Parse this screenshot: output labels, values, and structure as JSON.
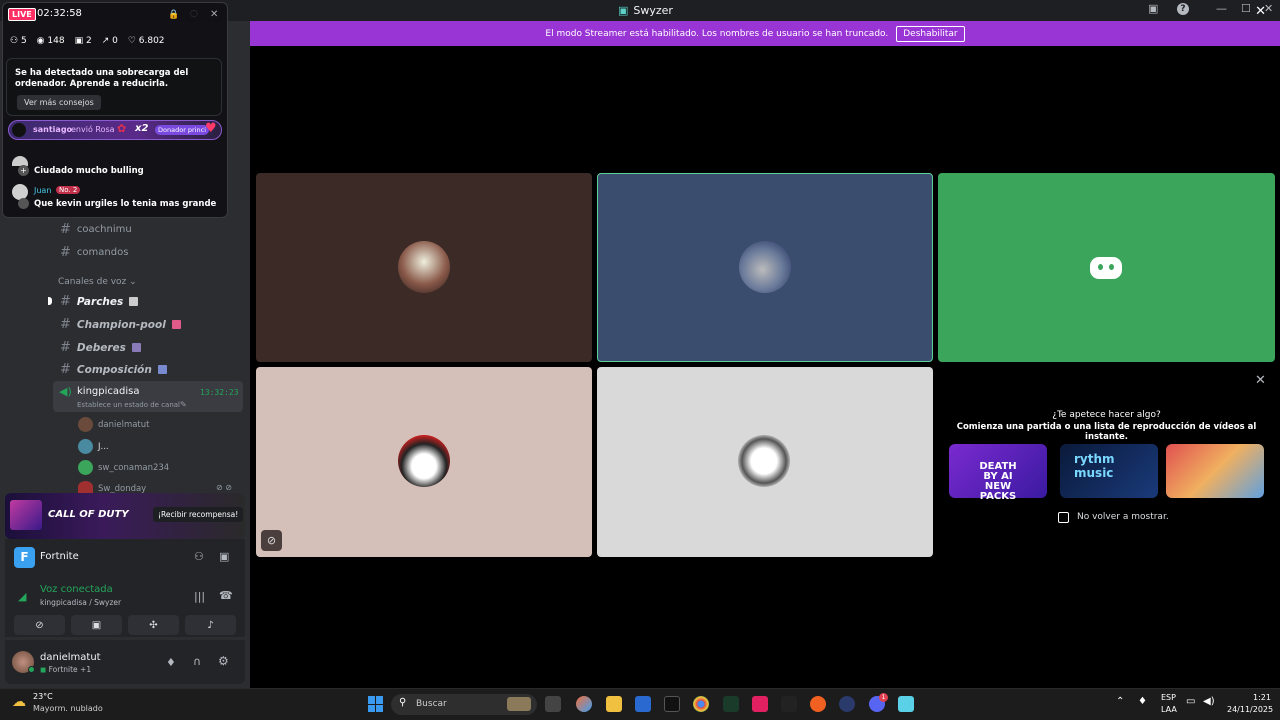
{
  "window": {
    "title": "Swyzer"
  },
  "banner": {
    "text": "El modo Streamer está habilitado. Los nombres de usuario se han truncado.",
    "button": "Deshabilitar"
  },
  "overlay": {
    "live_label": "LIVE",
    "time": "02:32:58",
    "stats": {
      "viewers_icon_value": "5",
      "views": "148",
      "gifts": "2",
      "shares": "0",
      "likes": "6.802"
    },
    "notice": "Se ha detectado una sobrecarga del ordenador. Aprende a reducirla.",
    "notice_button": "Ver más consejos",
    "gift": {
      "user": "santiago",
      "action": "envió Rosa",
      "count": "x2",
      "badge": "Donador princi"
    },
    "chat": [
      {
        "user": "",
        "text": "Ciudado mucho bulling"
      },
      {
        "user": "Juan",
        "badge": "No. 2",
        "text": "Que kevin urgiles lo tenia mas grande"
      }
    ]
  },
  "sidebar": {
    "text_channels": [
      "coachnimu",
      "comandos"
    ],
    "voice_header": "Canales de voz",
    "voice_channels": [
      "Parches",
      "Champion-pool",
      "Deberes",
      "Composición"
    ],
    "active_voice": {
      "name": "kingpicadisa",
      "timer": "13:32:23",
      "status_hint": "Establece un estado de canal"
    },
    "members": [
      "danielmatut",
      "J...",
      "sw_conaman234",
      "Sw_donday"
    ]
  },
  "promo": {
    "game": "CALL OF DUTY",
    "button": "¡Recibir recompensa!"
  },
  "activity_status": {
    "game": "Fortnite"
  },
  "voice": {
    "status": "Voz conectada",
    "location": "kingpicadisa / Swyzer"
  },
  "user": {
    "name": "danielmatut",
    "activity": "Fortnite +1"
  },
  "activity_panel": {
    "title": "¿Te apetece hacer algo?",
    "subtitle": "Comienza una partida o una lista de reproducción de vídeos al instante.",
    "cards": [
      "DEATH BY AI NEW PACKS",
      "rythm music",
      ""
    ],
    "dont_show": "No volver a mostrar."
  },
  "taskbar": {
    "weather_temp": "23°C",
    "weather_text": "Mayorm. nublado",
    "search_placeholder": "Buscar",
    "lang1": "ESP",
    "lang2": "LAA",
    "time": "1:21",
    "date": "24/11/2025",
    "badge": "1"
  },
  "colors": {
    "banner": "#9a35d5",
    "tile_brown": "#3b2a26",
    "tile_blue": "#3a4d6e",
    "tile_green": "#3ba55c",
    "tile_pink": "#d5bfb9",
    "tile_gray": "#d9d9d9",
    "connected": "#23a55a"
  }
}
